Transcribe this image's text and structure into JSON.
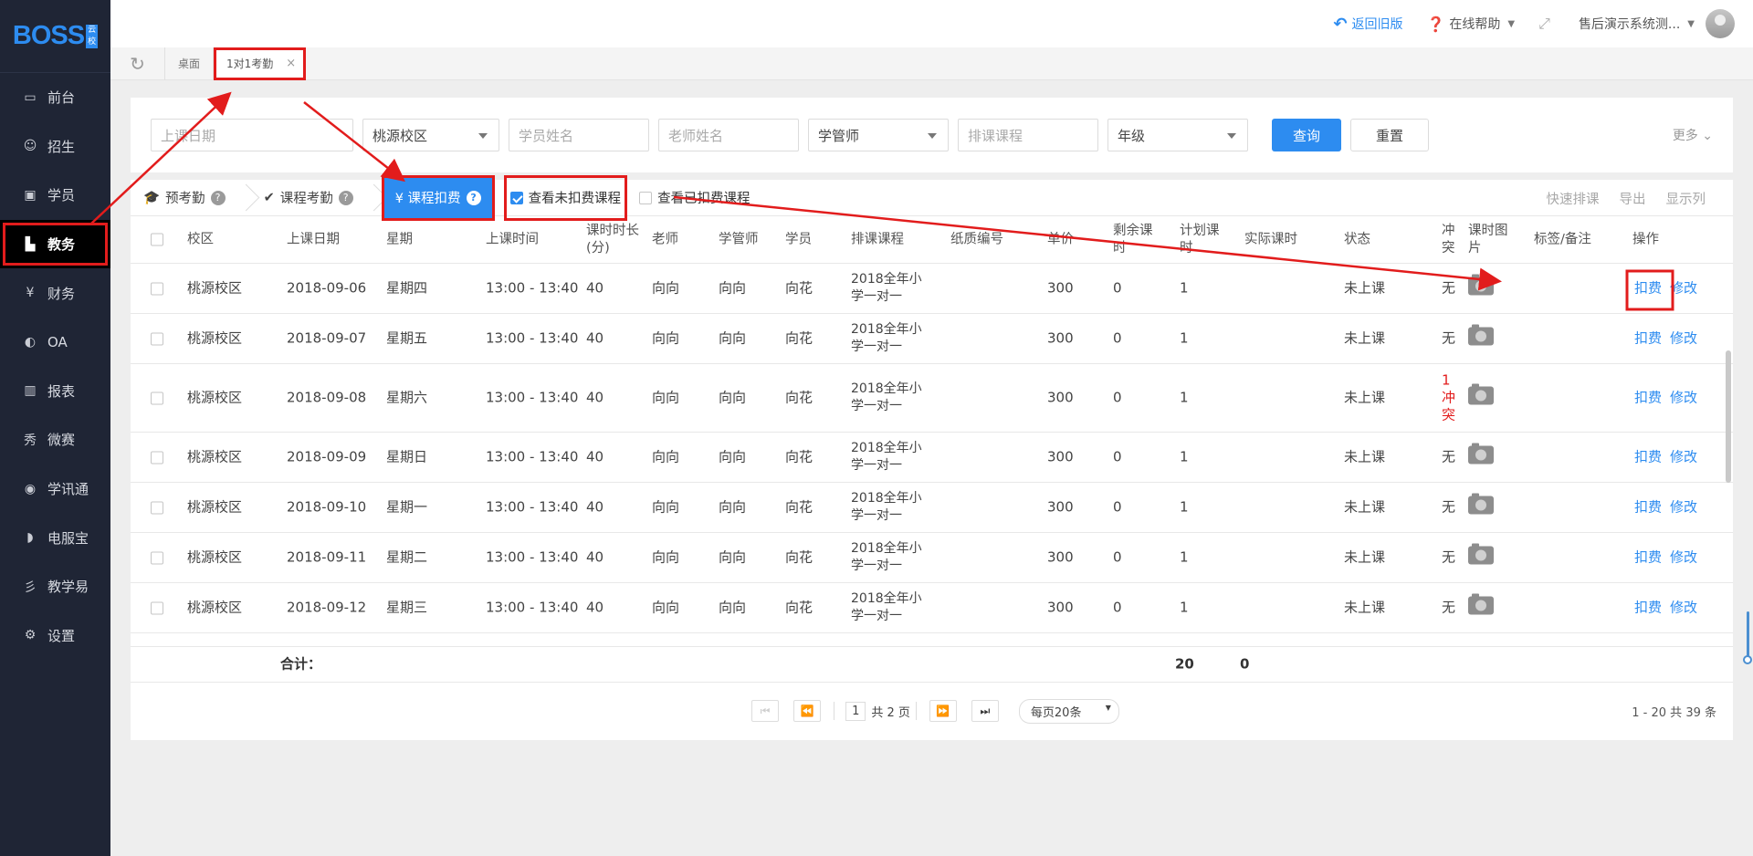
{
  "brand": {
    "logo_text": "BOSS",
    "logo_tag": "云校"
  },
  "sidebar": {
    "items": [
      {
        "label": "前台",
        "icon": "calendar-icon"
      },
      {
        "label": "招生",
        "icon": "user-plus-icon"
      },
      {
        "label": "学员",
        "icon": "student-card-icon"
      },
      {
        "label": "教务",
        "icon": "book-icon"
      },
      {
        "label": "财务",
        "icon": "yen-icon"
      },
      {
        "label": "OA",
        "icon": "oa-icon"
      },
      {
        "label": "报表",
        "icon": "bar-chart-icon"
      },
      {
        "label": "微赛",
        "icon": "weisai-icon"
      },
      {
        "label": "学讯通",
        "icon": "location-icon"
      },
      {
        "label": "电服宝",
        "icon": "phone-service-icon"
      },
      {
        "label": "教学易",
        "icon": "teaching-icon"
      },
      {
        "label": "设置",
        "icon": "gear-icon"
      }
    ],
    "active_index": 3
  },
  "header": {
    "old_version": "返回旧版",
    "help": "在线帮助",
    "user": "售后演示系统测..."
  },
  "tabs": [
    {
      "label": "桌面"
    },
    {
      "label": "1对1考勤",
      "close": "×"
    }
  ],
  "filter": {
    "date_placeholder": "上课日期",
    "campus": "桃源校区",
    "student_placeholder": "学员姓名",
    "teacher_placeholder": "老师姓名",
    "manager": "学管师",
    "course_placeholder": "排课课程",
    "grade": "年级",
    "query": "查询",
    "reset": "重置",
    "more": "更多"
  },
  "toolbar": {
    "tab_pre": "预考勤",
    "tab_course": "课程考勤",
    "tab_deduct": "¥ 课程扣费",
    "chk_unpaid": "查看未扣费课程",
    "chk_paid": "查看已扣费课程",
    "quick": "快速排课",
    "export": "导出",
    "columns": "显示列"
  },
  "table": {
    "headers": {
      "campus": "校区",
      "date": "上课日期",
      "weekday": "星期",
      "time": "上课时间",
      "duration_1": "课时时长",
      "duration_2": "(分)",
      "teacher": "老师",
      "manager": "学管师",
      "student": "学员",
      "course": "排课课程",
      "paper_no": "纸质编号",
      "price": "单价",
      "remain_1": "剩余课",
      "remain_2": "时",
      "plan_1": "计划课",
      "plan_2": "时",
      "actual": "实际课时",
      "status": "状态",
      "conflict_1": "冲",
      "conflict_2": "突",
      "photo_1": "课时图",
      "photo_2": "片",
      "tag": "标签/备注",
      "op": "操作"
    },
    "rows": [
      {
        "campus": "桃源校区",
        "date": "2018-09-06",
        "weekday": "星期四",
        "time": "13:00 - 13:40",
        "duration": "40",
        "teacher": "向向",
        "manager": "向向",
        "student": "向花",
        "course_1": "2018全年小",
        "course_2": "学一对一",
        "price": "300",
        "remain": "0",
        "plan": "1",
        "status": "未上课",
        "conflict": "无",
        "deduct": "扣费",
        "edit": "修改"
      },
      {
        "campus": "桃源校区",
        "date": "2018-09-07",
        "weekday": "星期五",
        "time": "13:00 - 13:40",
        "duration": "40",
        "teacher": "向向",
        "manager": "向向",
        "student": "向花",
        "course_1": "2018全年小",
        "course_2": "学一对一",
        "price": "300",
        "remain": "0",
        "plan": "1",
        "status": "未上课",
        "conflict": "无",
        "deduct": "扣费",
        "edit": "修改"
      },
      {
        "campus": "桃源校区",
        "date": "2018-09-08",
        "weekday": "星期六",
        "time": "13:00 - 13:40",
        "duration": "40",
        "teacher": "向向",
        "manager": "向向",
        "student": "向花",
        "course_1": "2018全年小",
        "course_2": "学一对一",
        "price": "300",
        "remain": "0",
        "plan": "1",
        "status": "未上课",
        "conflict_1": "1",
        "conflict_2": "冲",
        "conflict_3": "突",
        "deduct": "扣费",
        "edit": "修改"
      },
      {
        "campus": "桃源校区",
        "date": "2018-09-09",
        "weekday": "星期日",
        "time": "13:00 - 13:40",
        "duration": "40",
        "teacher": "向向",
        "manager": "向向",
        "student": "向花",
        "course_1": "2018全年小",
        "course_2": "学一对一",
        "price": "300",
        "remain": "0",
        "plan": "1",
        "status": "未上课",
        "conflict": "无",
        "deduct": "扣费",
        "edit": "修改"
      },
      {
        "campus": "桃源校区",
        "date": "2018-09-10",
        "weekday": "星期一",
        "time": "13:00 - 13:40",
        "duration": "40",
        "teacher": "向向",
        "manager": "向向",
        "student": "向花",
        "course_1": "2018全年小",
        "course_2": "学一对一",
        "price": "300",
        "remain": "0",
        "plan": "1",
        "status": "未上课",
        "conflict": "无",
        "deduct": "扣费",
        "edit": "修改"
      },
      {
        "campus": "桃源校区",
        "date": "2018-09-11",
        "weekday": "星期二",
        "time": "13:00 - 13:40",
        "duration": "40",
        "teacher": "向向",
        "manager": "向向",
        "student": "向花",
        "course_1": "2018全年小",
        "course_2": "学一对一",
        "price": "300",
        "remain": "0",
        "plan": "1",
        "status": "未上课",
        "conflict": "无",
        "deduct": "扣费",
        "edit": "修改"
      },
      {
        "campus": "桃源校区",
        "date": "2018-09-12",
        "weekday": "星期三",
        "time": "13:00 - 13:40",
        "duration": "40",
        "teacher": "向向",
        "manager": "向向",
        "student": "向花",
        "course_1": "2018全年小",
        "course_2": "学一对一",
        "price": "300",
        "remain": "0",
        "plan": "1",
        "status": "未上课",
        "conflict": "无",
        "deduct": "扣费",
        "edit": "修改"
      }
    ],
    "total": {
      "label": "合计：",
      "plan": "20",
      "actual": "0"
    }
  },
  "pager": {
    "page": "1",
    "total_pages": "共 2 页",
    "page_size": "每页20条",
    "info": "1 - 20   共 39 条"
  },
  "colors": {
    "accent": "#2d8cf0",
    "annotation": "#e21c1c",
    "sidebar_bg": "#1f2535"
  }
}
